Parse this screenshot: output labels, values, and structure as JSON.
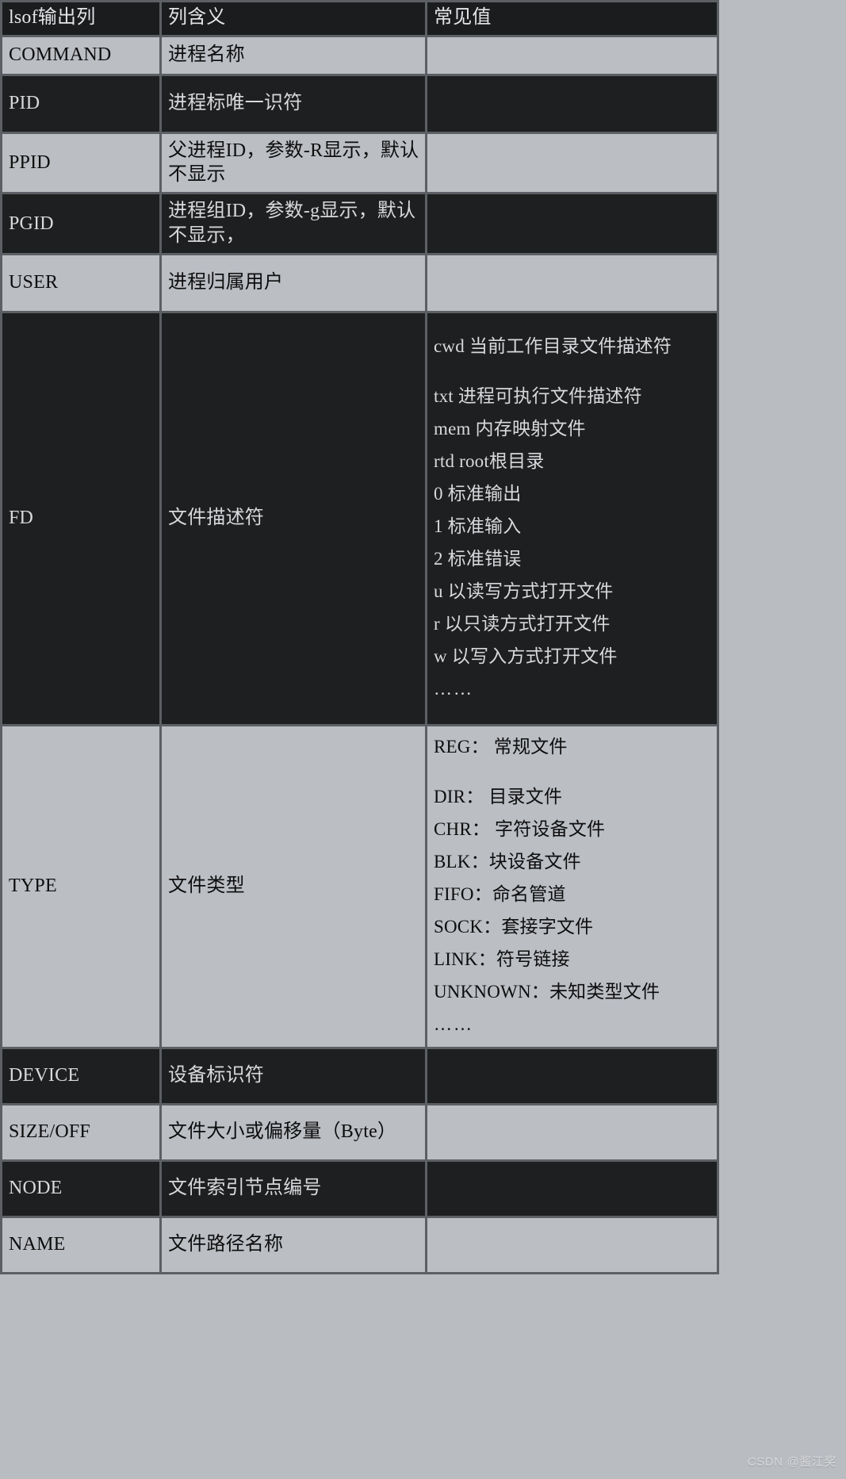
{
  "watermark": "CSDN @酱江奖",
  "colors": {
    "page_background": "#b9bcc1",
    "grid_line": "#5c5f63",
    "dark_row_background": "#1e1f20",
    "dark_row_text": "#d7d9dc",
    "light_row_background": "#bbbec3",
    "light_row_text": "#0d0d0e",
    "header_background": "#1b1c1d",
    "header_text": "#e3e5e8"
  },
  "table": {
    "headers": [
      "lsof输出列",
      "列含义",
      "常见值"
    ],
    "rows": [
      {
        "column": "COMMAND",
        "meaning": "进程名称",
        "values": []
      },
      {
        "column": "PID",
        "meaning": "进程标唯一识符",
        "values": []
      },
      {
        "column": "PPID",
        "meaning": "父进程ID，参数-R显示，默认不显示",
        "values": []
      },
      {
        "column": "PGID",
        "meaning": "进程组ID，参数-g显示，默认不显示，",
        "values": []
      },
      {
        "column": "USER",
        "meaning": "进程归属用户",
        "values": []
      },
      {
        "column": "FD",
        "meaning": "文件描述符",
        "values": [
          "cwd 当前工作目录文件描述符",
          "txt 进程可执行文件描述符",
          "mem 内存映射文件",
          "rtd root根目录",
          "0 标准输出",
          "1 标准输入",
          "2 标准错误",
          "u 以读写方式打开文件",
          "r 以只读方式打开文件",
          "w 以写入方式打开文件",
          "……"
        ]
      },
      {
        "column": "TYPE",
        "meaning": "文件类型",
        "values": [
          "REG： 常规文件",
          "DIR： 目录文件",
          "CHR： 字符设备文件",
          "BLK：块设备文件",
          "FIFO：命名管道",
          "SOCK：套接字文件",
          "LINK：符号链接",
          "UNKNOWN：未知类型文件",
          "……"
        ]
      },
      {
        "column": "DEVICE",
        "meaning": "设备标识符",
        "values": []
      },
      {
        "column": "SIZE/OFF",
        "meaning": "文件大小或偏移量（Byte）",
        "values": []
      },
      {
        "column": "NODE",
        "meaning": "文件索引节点编号",
        "values": []
      },
      {
        "column": "NAME",
        "meaning": "文件路径名称",
        "values": []
      }
    ]
  }
}
